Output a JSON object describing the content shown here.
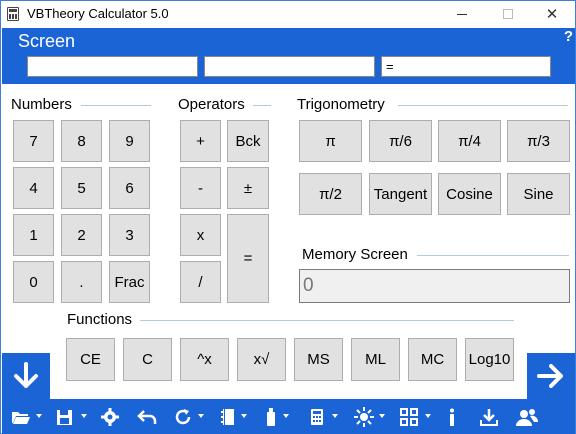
{
  "window": {
    "title": "VBTheory Calculator 5.0",
    "minimize_glyph": "",
    "close_glyph": "✕"
  },
  "screen": {
    "title": "Screen",
    "help": "?",
    "field1": "",
    "field2": "",
    "field3": "="
  },
  "sections": {
    "numbers": "Numbers",
    "operators": "Operators",
    "trigonometry": "Trigonometry",
    "memory": "Memory Screen",
    "functions": "Functions"
  },
  "numbers": [
    "7",
    "8",
    "9",
    "4",
    "5",
    "6",
    "1",
    "2",
    "3",
    "0",
    ".",
    "Frac"
  ],
  "operators": {
    "plus": "+",
    "back": "Bck",
    "minus": "-",
    "plusminus": "±",
    "times": "x",
    "equals": "=",
    "divide": "/"
  },
  "trig": [
    "π",
    "π/6",
    "π/4",
    "π/3",
    "π/2",
    "Tangent",
    "Cosine",
    "Sine"
  ],
  "memory_value": "0",
  "functions": [
    "CE",
    "C",
    "^x",
    "x√",
    "MS",
    "ML",
    "MC",
    "Log10"
  ],
  "icons": {
    "left_panel": "arrow-down-icon",
    "right_panel": "arrow-right-icon",
    "toolbar": [
      "folder-open-icon",
      "save-icon",
      "settings-icon",
      "undo-icon",
      "refresh-icon",
      "notebook-icon",
      "usb-drive-icon",
      "calculator-icon",
      "sun-icon",
      "grid-icon",
      "info-icon",
      "download-icon",
      "users-icon"
    ]
  },
  "colors": {
    "accent": "#1a64d6",
    "button": "#e1e1e1",
    "button_border": "#adadad"
  }
}
